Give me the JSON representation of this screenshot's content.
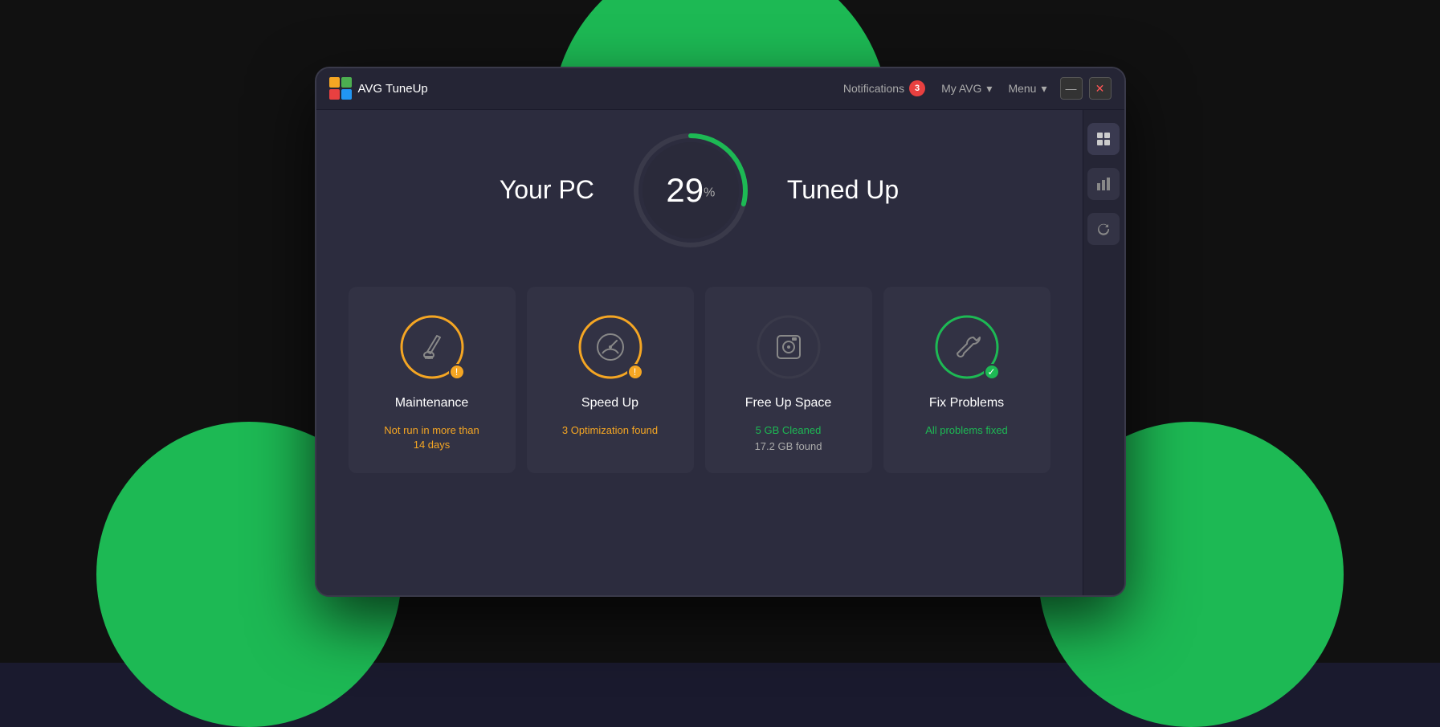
{
  "app": {
    "logo_text": "AVG  TuneUp",
    "title": "AVG TuneUp"
  },
  "header": {
    "notifications_label": "Notifications",
    "notifications_count": "3",
    "my_avg_label": "My AVG",
    "menu_label": "Menu",
    "minimize_label": "—",
    "close_label": "✕"
  },
  "score": {
    "prefix": "Your PC",
    "value": "29",
    "percent": "%",
    "suffix": "Tuned Up",
    "arc_progress": 29,
    "arc_color": "#1db954",
    "track_color": "#3a3a4a"
  },
  "cards": [
    {
      "id": "maintenance",
      "title": "Maintenance",
      "status_line1": "Not run in more than",
      "status_line2": "14 days",
      "status_type": "warning",
      "ring_color": "#f5a623",
      "icon_type": "broom",
      "badge_type": "warning"
    },
    {
      "id": "speedup",
      "title": "Speed Up",
      "status_line1": "3 Optimization found",
      "status_line2": "",
      "status_type": "warning",
      "ring_color": "#f5a623",
      "icon_type": "speedometer",
      "badge_type": "warning"
    },
    {
      "id": "freespace",
      "title": "Free Up Space",
      "status_line1": "5 GB Cleaned",
      "status_line2": "17.2 GB found",
      "status_type": "success",
      "ring_color": "#3a3a4a",
      "icon_type": "disk",
      "badge_type": "none"
    },
    {
      "id": "fixproblems",
      "title": "Fix Problems",
      "status_line1": "All problems fixed",
      "status_line2": "",
      "status_type": "success",
      "ring_color": "#1db954",
      "icon_type": "wrench",
      "badge_type": "success"
    }
  ],
  "sidebar_icons": [
    {
      "id": "grid",
      "unicode": "⊞"
    },
    {
      "id": "chart",
      "unicode": "▦"
    },
    {
      "id": "refresh",
      "unicode": "↺"
    }
  ]
}
